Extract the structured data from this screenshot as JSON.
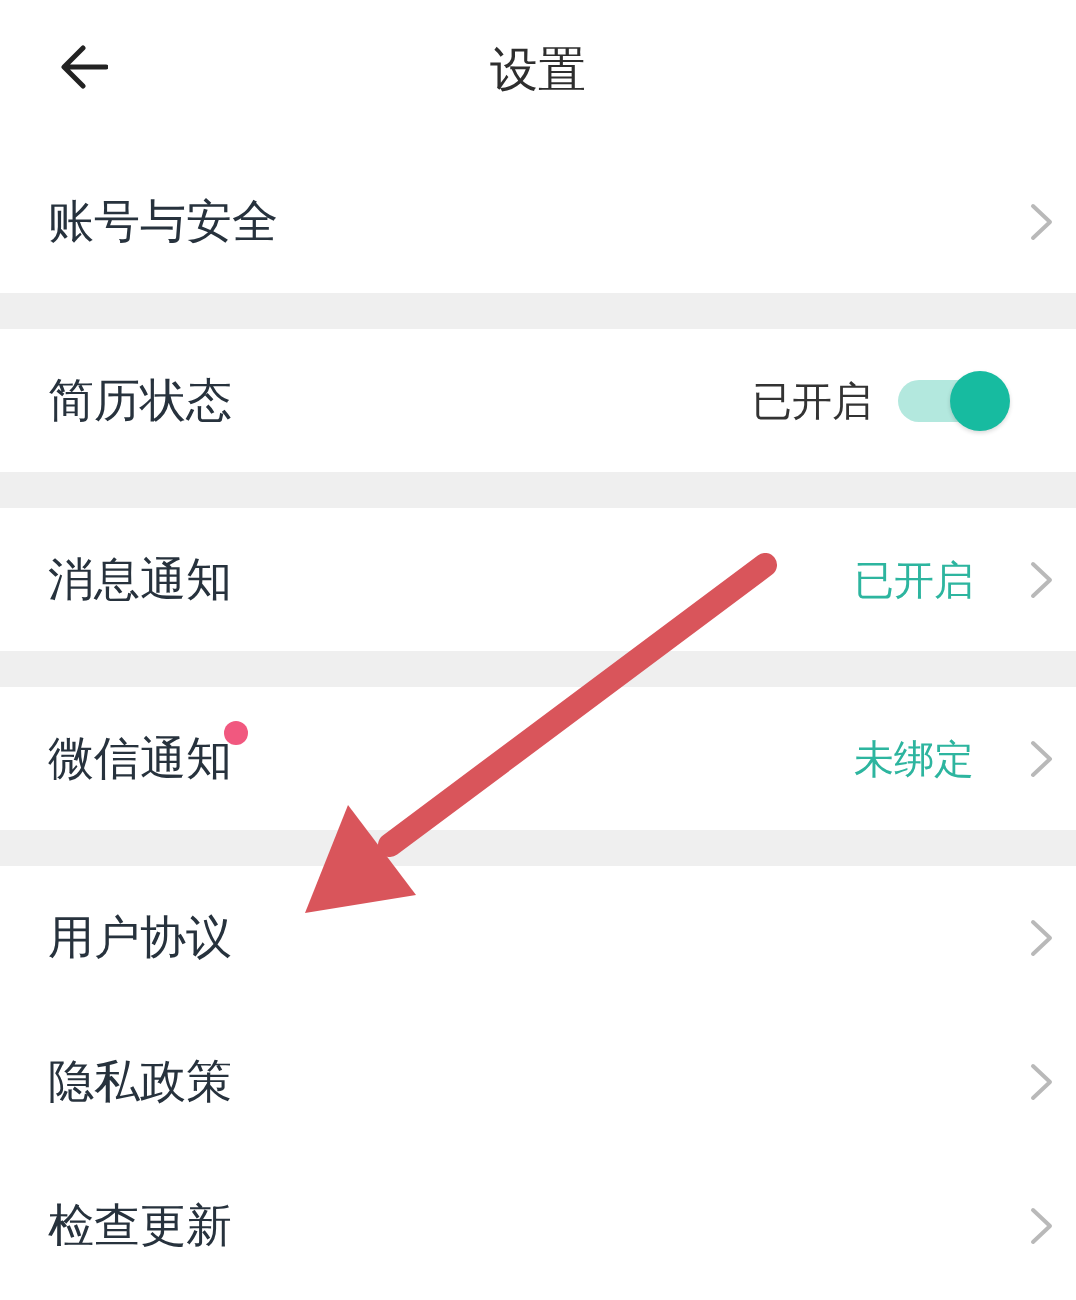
{
  "header": {
    "title": "设置"
  },
  "groups": [
    {
      "items": [
        {
          "kind": "link",
          "label": "账号与安全",
          "badge": false
        }
      ]
    },
    {
      "items": [
        {
          "kind": "toggle",
          "label": "简历状态",
          "status": "已开启",
          "on": true,
          "badge": false
        }
      ]
    },
    {
      "items": [
        {
          "kind": "link",
          "label": "消息通知",
          "status": "已开启",
          "badge": false
        }
      ]
    },
    {
      "items": [
        {
          "kind": "link",
          "label": "微信通知",
          "status": "未绑定",
          "badge": true
        }
      ]
    },
    {
      "items": [
        {
          "kind": "link",
          "label": "用户协议",
          "badge": false
        },
        {
          "kind": "link",
          "label": "隐私政策",
          "badge": false
        },
        {
          "kind": "link",
          "label": "检查更新",
          "badge": false
        }
      ]
    }
  ]
}
